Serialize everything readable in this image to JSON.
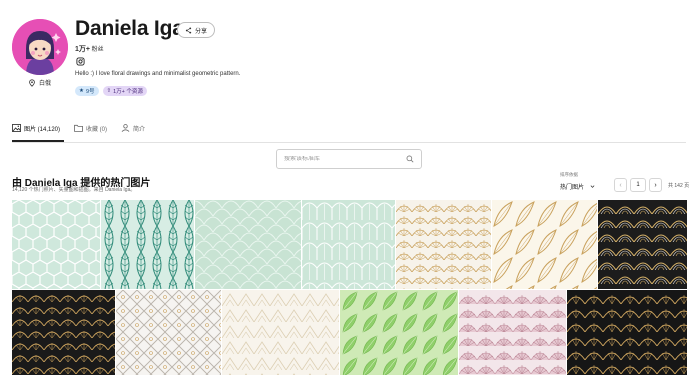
{
  "profile": {
    "name": "Daniela Iga",
    "share_label": "分享",
    "followers_count": "1万+",
    "followers_label": "粉丝",
    "bio": "Hello :) I love floral drawings and minimalist geometric pattern.",
    "location": "白俄",
    "badges": {
      "rank": "9号",
      "resources": "1万+ 个资源"
    }
  },
  "tabs": [
    {
      "label": "图片 (14,120)",
      "icon": "image-icon"
    },
    {
      "label": "收藏 (0)",
      "icon": "folder-icon"
    },
    {
      "label": "简介",
      "icon": "user-icon"
    }
  ],
  "search": {
    "placeholder": "搜索该标准库"
  },
  "section": {
    "title": "由 Daniela Iga 提供的热门图片",
    "subtitle": "14,120 个热门照片、矢量图和插图。来自 Daniela Iga。"
  },
  "sort": {
    "label": "排序依据",
    "value": "热门图片"
  },
  "pagination": {
    "current": "1",
    "total": "共 142 页"
  },
  "colors": {
    "avatar_bg": "#e64fb5",
    "mint": "#cfe5d9",
    "gold": "#c9a15c",
    "dark": "#1c1c1c"
  },
  "thumbnails": [
    {
      "pattern": "mint-hexagon"
    },
    {
      "pattern": "teal-leaves"
    },
    {
      "pattern": "mint-scales"
    },
    {
      "pattern": "mint-arches"
    },
    {
      "pattern": "gold-fan-white"
    },
    {
      "pattern": "gold-leaves-white"
    },
    {
      "pattern": "black-gold-art-deco"
    },
    {
      "pattern": "black-gold-scallops"
    },
    {
      "pattern": "grey-lattice"
    },
    {
      "pattern": "beige-geometric"
    },
    {
      "pattern": "green-leaves"
    },
    {
      "pattern": "pink-fans"
    },
    {
      "pattern": "black-gold-fans"
    }
  ]
}
